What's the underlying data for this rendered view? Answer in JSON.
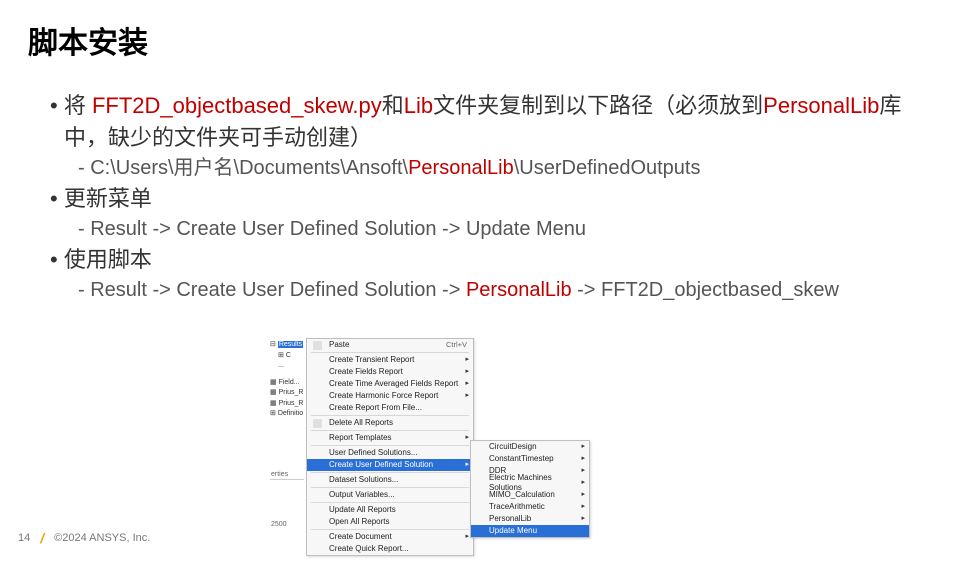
{
  "title": "脚本安装",
  "bullets": {
    "b1_pre": "将 ",
    "b1_red1": "FFT2D_objectbased_skew.py",
    "b1_mid": "和",
    "b1_red2": "Lib",
    "b1_post": "文件夹复制到以下路径（必须放到",
    "b1_red3": "PersonalLib",
    "b1_tail": "库中，缺少的文件夹可手动创建）",
    "b1_sub_pre": "C:\\Users\\用户名\\Documents\\Ansoft\\",
    "b1_sub_red": "PersonalLib",
    "b1_sub_post": "\\UserDefinedOutputs",
    "b2": "更新菜单",
    "b2_sub": "Result -> Create User Defined Solution -> Update Menu",
    "b3": "使用脚本",
    "b3_sub_pre": "Result -> Create User Defined Solution -> ",
    "b3_sub_red": "PersonalLib",
    "b3_sub_post": " -> FFT2D_objectbased_skew"
  },
  "footer": {
    "page": "14",
    "copyright": "©2024 ANSYS, Inc."
  },
  "tree": {
    "results": "Results",
    "i1": "C",
    "i2": "...",
    "fields": "Field...",
    "prius1": "Prius_R",
    "prius2": "Prius_R",
    "defs": "Definitio"
  },
  "menu1": {
    "paste": "Paste",
    "paste_sc": "Ctrl+V",
    "create_transient": "Create Transient Report",
    "create_fields": "Create Fields Report",
    "create_time_avg": "Create Time Averaged Fields Report",
    "create_harmonic": "Create Harmonic Force Report",
    "create_from_file": "Create Report From File...",
    "delete_all": "Delete All Reports",
    "report_templates": "Report Templates",
    "uds": "User Defined Solutions...",
    "cuds": "Create User Defined Solution",
    "dataset": "Dataset Solutions...",
    "output_vars": "Output Variables...",
    "update_all": "Update All Reports",
    "open_all": "Open All Reports",
    "create_doc": "Create Document",
    "create_quick": "Create Quick Report..."
  },
  "menu2": {
    "circuitdesign": "CircuitDesign",
    "constanttimestep": "ConstantTimestep",
    "ddr": "DDR",
    "ems": "Electric Machines Solutions",
    "mimo": "MIMO_Calculation",
    "trace": "TraceArithmetic",
    "personallib": "PersonalLib",
    "update": "Update Menu"
  },
  "sidepanel": {
    "label": "erties",
    "val": "2500"
  }
}
